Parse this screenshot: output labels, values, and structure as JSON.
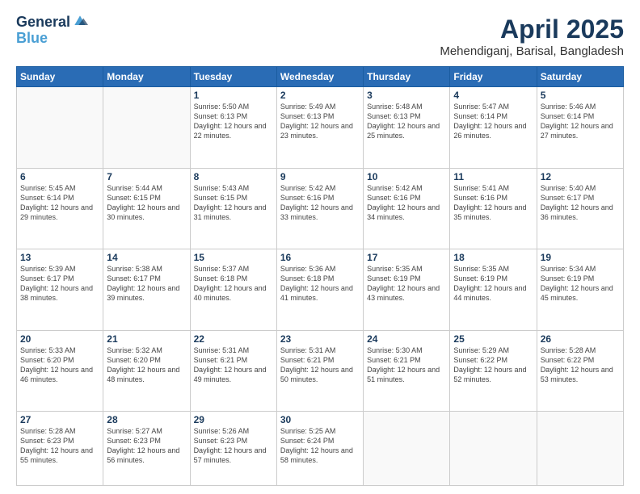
{
  "logo": {
    "line1": "General",
    "line2": "Blue"
  },
  "title": "April 2025",
  "subtitle": "Mehendiganj, Barisal, Bangladesh",
  "weekdays": [
    "Sunday",
    "Monday",
    "Tuesday",
    "Wednesday",
    "Thursday",
    "Friday",
    "Saturday"
  ],
  "weeks": [
    [
      {
        "day": "",
        "info": ""
      },
      {
        "day": "",
        "info": ""
      },
      {
        "day": "1",
        "info": "Sunrise: 5:50 AM\nSunset: 6:13 PM\nDaylight: 12 hours and 22 minutes."
      },
      {
        "day": "2",
        "info": "Sunrise: 5:49 AM\nSunset: 6:13 PM\nDaylight: 12 hours and 23 minutes."
      },
      {
        "day": "3",
        "info": "Sunrise: 5:48 AM\nSunset: 6:13 PM\nDaylight: 12 hours and 25 minutes."
      },
      {
        "day": "4",
        "info": "Sunrise: 5:47 AM\nSunset: 6:14 PM\nDaylight: 12 hours and 26 minutes."
      },
      {
        "day": "5",
        "info": "Sunrise: 5:46 AM\nSunset: 6:14 PM\nDaylight: 12 hours and 27 minutes."
      }
    ],
    [
      {
        "day": "6",
        "info": "Sunrise: 5:45 AM\nSunset: 6:14 PM\nDaylight: 12 hours and 29 minutes."
      },
      {
        "day": "7",
        "info": "Sunrise: 5:44 AM\nSunset: 6:15 PM\nDaylight: 12 hours and 30 minutes."
      },
      {
        "day": "8",
        "info": "Sunrise: 5:43 AM\nSunset: 6:15 PM\nDaylight: 12 hours and 31 minutes."
      },
      {
        "day": "9",
        "info": "Sunrise: 5:42 AM\nSunset: 6:16 PM\nDaylight: 12 hours and 33 minutes."
      },
      {
        "day": "10",
        "info": "Sunrise: 5:42 AM\nSunset: 6:16 PM\nDaylight: 12 hours and 34 minutes."
      },
      {
        "day": "11",
        "info": "Sunrise: 5:41 AM\nSunset: 6:16 PM\nDaylight: 12 hours and 35 minutes."
      },
      {
        "day": "12",
        "info": "Sunrise: 5:40 AM\nSunset: 6:17 PM\nDaylight: 12 hours and 36 minutes."
      }
    ],
    [
      {
        "day": "13",
        "info": "Sunrise: 5:39 AM\nSunset: 6:17 PM\nDaylight: 12 hours and 38 minutes."
      },
      {
        "day": "14",
        "info": "Sunrise: 5:38 AM\nSunset: 6:17 PM\nDaylight: 12 hours and 39 minutes."
      },
      {
        "day": "15",
        "info": "Sunrise: 5:37 AM\nSunset: 6:18 PM\nDaylight: 12 hours and 40 minutes."
      },
      {
        "day": "16",
        "info": "Sunrise: 5:36 AM\nSunset: 6:18 PM\nDaylight: 12 hours and 41 minutes."
      },
      {
        "day": "17",
        "info": "Sunrise: 5:35 AM\nSunset: 6:19 PM\nDaylight: 12 hours and 43 minutes."
      },
      {
        "day": "18",
        "info": "Sunrise: 5:35 AM\nSunset: 6:19 PM\nDaylight: 12 hours and 44 minutes."
      },
      {
        "day": "19",
        "info": "Sunrise: 5:34 AM\nSunset: 6:19 PM\nDaylight: 12 hours and 45 minutes."
      }
    ],
    [
      {
        "day": "20",
        "info": "Sunrise: 5:33 AM\nSunset: 6:20 PM\nDaylight: 12 hours and 46 minutes."
      },
      {
        "day": "21",
        "info": "Sunrise: 5:32 AM\nSunset: 6:20 PM\nDaylight: 12 hours and 48 minutes."
      },
      {
        "day": "22",
        "info": "Sunrise: 5:31 AM\nSunset: 6:21 PM\nDaylight: 12 hours and 49 minutes."
      },
      {
        "day": "23",
        "info": "Sunrise: 5:31 AM\nSunset: 6:21 PM\nDaylight: 12 hours and 50 minutes."
      },
      {
        "day": "24",
        "info": "Sunrise: 5:30 AM\nSunset: 6:21 PM\nDaylight: 12 hours and 51 minutes."
      },
      {
        "day": "25",
        "info": "Sunrise: 5:29 AM\nSunset: 6:22 PM\nDaylight: 12 hours and 52 minutes."
      },
      {
        "day": "26",
        "info": "Sunrise: 5:28 AM\nSunset: 6:22 PM\nDaylight: 12 hours and 53 minutes."
      }
    ],
    [
      {
        "day": "27",
        "info": "Sunrise: 5:28 AM\nSunset: 6:23 PM\nDaylight: 12 hours and 55 minutes."
      },
      {
        "day": "28",
        "info": "Sunrise: 5:27 AM\nSunset: 6:23 PM\nDaylight: 12 hours and 56 minutes."
      },
      {
        "day": "29",
        "info": "Sunrise: 5:26 AM\nSunset: 6:23 PM\nDaylight: 12 hours and 57 minutes."
      },
      {
        "day": "30",
        "info": "Sunrise: 5:25 AM\nSunset: 6:24 PM\nDaylight: 12 hours and 58 minutes."
      },
      {
        "day": "",
        "info": ""
      },
      {
        "day": "",
        "info": ""
      },
      {
        "day": "",
        "info": ""
      }
    ]
  ]
}
